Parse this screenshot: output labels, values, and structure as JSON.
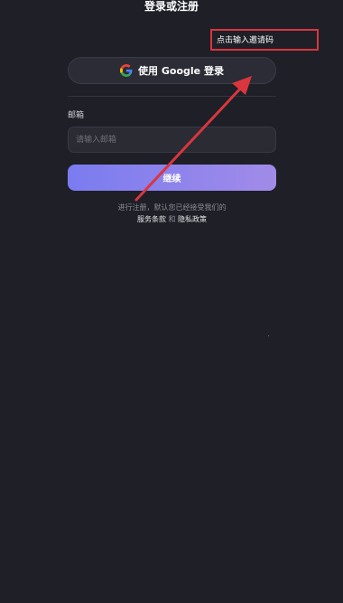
{
  "header": {
    "title": "登录或注册"
  },
  "invite": {
    "label": "点击输入邀请码"
  },
  "google": {
    "label": "使用 Google 登录",
    "icon": "google-icon"
  },
  "email": {
    "label": "邮箱",
    "placeholder": "请输入邮箱",
    "value": ""
  },
  "continue": {
    "label": "继续"
  },
  "terms": {
    "line1": "进行注册，默认您已经接受我们的",
    "service": "服务条款",
    "and": "和",
    "privacy": "隐私政策"
  },
  "annotation": {
    "color": "#d9363e"
  }
}
